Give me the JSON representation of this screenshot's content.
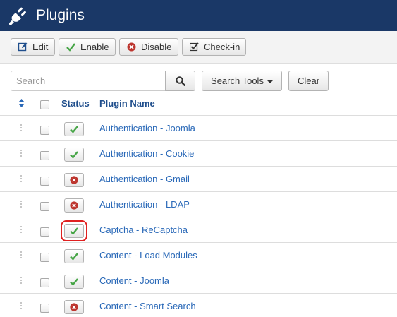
{
  "header": {
    "title": "Plugins",
    "icon": "plug-icon"
  },
  "toolbar": {
    "edit_label": "Edit",
    "enable_label": "Enable",
    "disable_label": "Disable",
    "checkin_label": "Check-in"
  },
  "filters": {
    "search_placeholder": "Search",
    "search_value": "",
    "search_tools_label": "Search Tools",
    "clear_label": "Clear"
  },
  "table": {
    "headers": {
      "status": "Status",
      "plugin_name": "Plugin Name"
    },
    "rows": [
      {
        "name": "Authentication - Joomla",
        "status": "enabled"
      },
      {
        "name": "Authentication - Cookie",
        "status": "enabled"
      },
      {
        "name": "Authentication - Gmail",
        "status": "disabled"
      },
      {
        "name": "Authentication - LDAP",
        "status": "disabled"
      },
      {
        "name": "Captcha - ReCaptcha",
        "status": "enabled",
        "highlighted": true
      },
      {
        "name": "Content - Load Modules",
        "status": "enabled"
      },
      {
        "name": "Content - Joomla",
        "status": "enabled"
      },
      {
        "name": "Content - Smart Search",
        "status": "disabled"
      }
    ]
  },
  "colors": {
    "header_bg": "#1a3867",
    "link": "#2a69b8",
    "enabled": "#46a546",
    "disabled": "#bd362f",
    "highlight": "#e02020"
  }
}
